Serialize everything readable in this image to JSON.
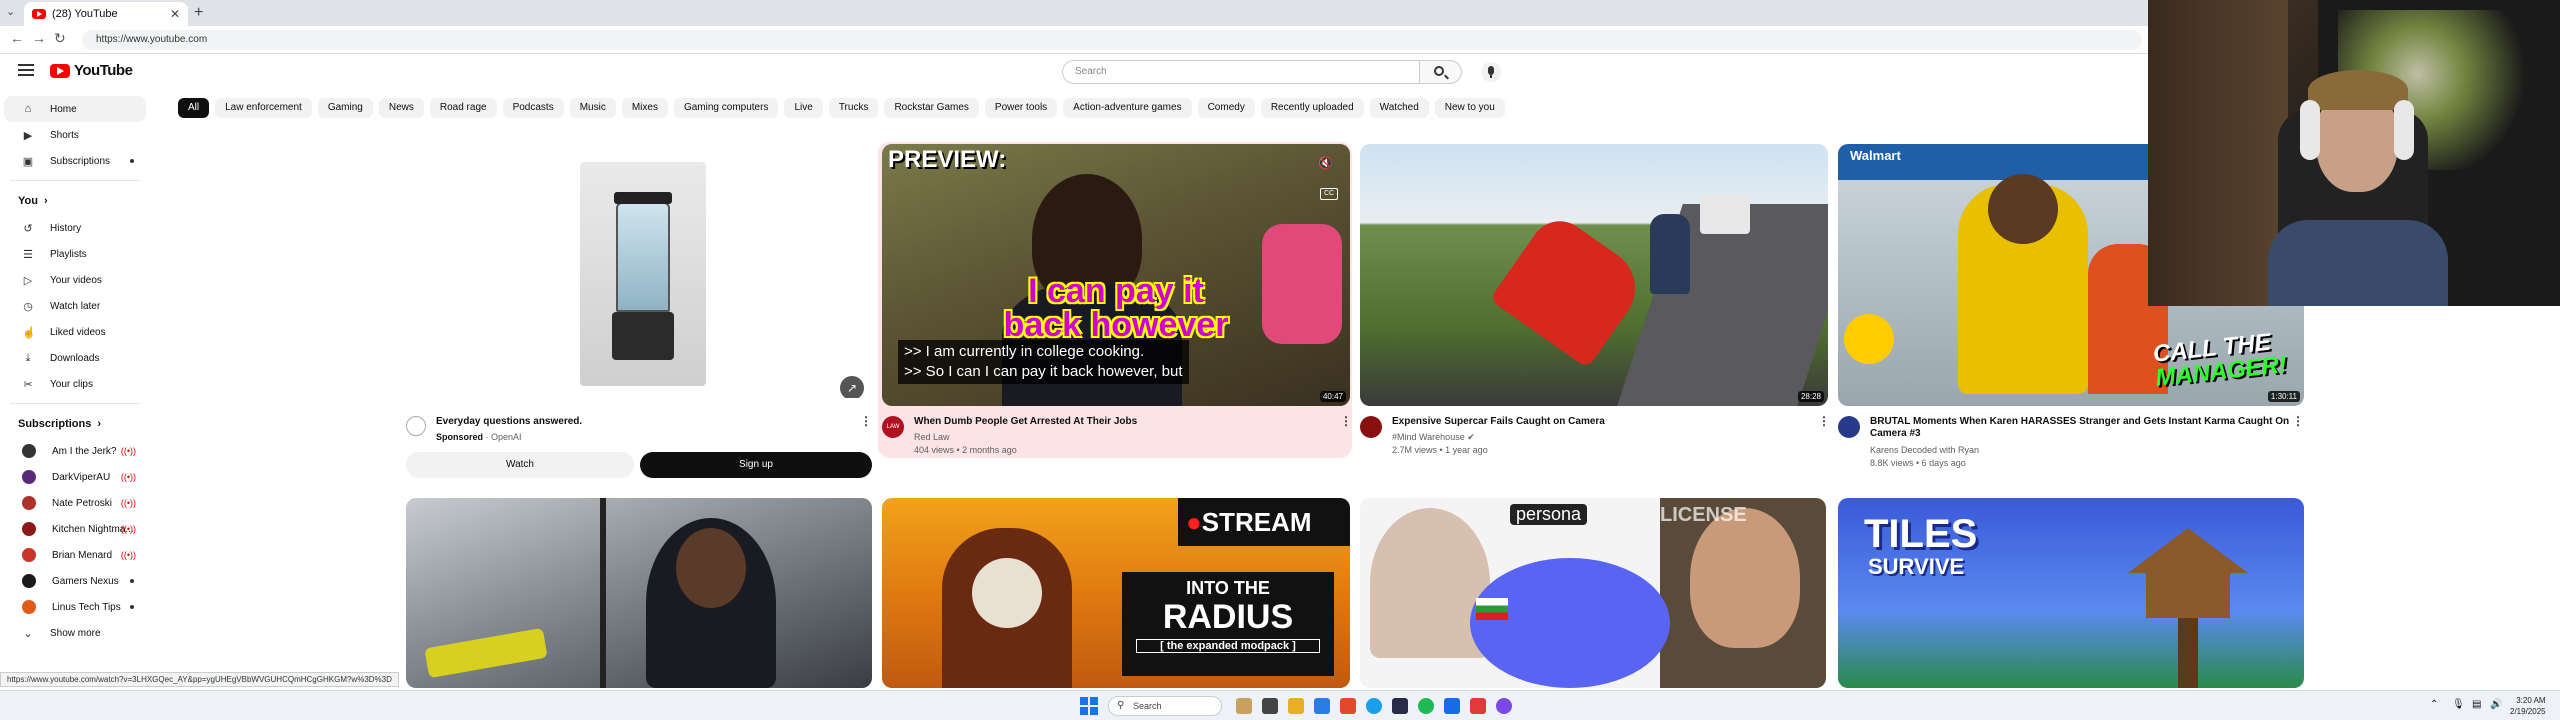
{
  "browser": {
    "tab_title": "(28) YouTube",
    "url": "https://www.youtube.com",
    "status_url": "https://www.youtube.com/watch?v=3LHXGQec_AY&pp=ygUHEgVBbWVGUHCQmHCgGHKGM?w%3D%3D"
  },
  "header": {
    "logo_text": "YouTube",
    "search_placeholder": "Search"
  },
  "chips": [
    "All",
    "Law enforcement",
    "Gaming",
    "News",
    "Road rage",
    "Podcasts",
    "Music",
    "Mixes",
    "Gaming computers",
    "Live",
    "Trucks",
    "Rockstar Games",
    "Power tools",
    "Action-adventure games",
    "Comedy",
    "Recently uploaded",
    "Watched",
    "New to you"
  ],
  "sidebar": {
    "main": [
      {
        "label": "Home",
        "icon": "home-icon"
      },
      {
        "label": "Shorts",
        "icon": "shorts-icon"
      },
      {
        "label": "Subscriptions",
        "icon": "subscriptions-icon"
      }
    ],
    "you_heading": "You",
    "you": [
      {
        "label": "History",
        "icon": "history-icon"
      },
      {
        "label": "Playlists",
        "icon": "playlists-icon"
      },
      {
        "label": "Your videos",
        "icon": "your-videos-icon"
      },
      {
        "label": "Watch later",
        "icon": "watch-later-icon"
      },
      {
        "label": "Liked videos",
        "icon": "liked-icon"
      },
      {
        "label": "Downloads",
        "icon": "downloads-icon"
      },
      {
        "label": "Your clips",
        "icon": "clips-icon"
      }
    ],
    "subs_heading": "Subscriptions",
    "subscriptions": [
      {
        "label": "Am I the Jerk?",
        "color": "#333333",
        "live": true
      },
      {
        "label": "DarkViperAU",
        "color": "#5a2a7a",
        "live": true
      },
      {
        "label": "Nate Petroski",
        "color": "#b0302a",
        "live": true
      },
      {
        "label": "Kitchen Nightma...",
        "color": "#8a1a1a",
        "live": true
      },
      {
        "label": "Brian Menard",
        "color": "#c8342a",
        "live": true
      },
      {
        "label": "Gamers Nexus",
        "color": "#1a1a1a",
        "live": false
      },
      {
        "label": "Linus Tech Tips",
        "color": "#e05a1a",
        "live": false
      }
    ],
    "show_more": "Show more"
  },
  "ad": {
    "title": "Everyday questions answered.",
    "sponsored": "Sponsored",
    "advertiser": "OpenAI",
    "watch_label": "Watch",
    "signup_label": "Sign up"
  },
  "videos": [
    {
      "title": "When Dumb People Get Arrested At Their Jobs",
      "channel": "Red Law",
      "meta": "404 views • 2 months ago",
      "duration": "40:47",
      "preview_label": "PREVIEW:",
      "caption_big1": "I can pay it",
      "caption_big2": "back however",
      "cc_line1": ">> I am currently in college cooking.",
      "cc_line2": ">> So I can I can pay it back however, but",
      "avatar_color": "#b01020"
    },
    {
      "title": "Expensive Supercar Fails Caught on Camera",
      "channel": "#Mind Warehouse",
      "meta": "2.7M views • 1 year ago",
      "duration": "28:28",
      "avatar_color": "#8a1010"
    },
    {
      "title": "BRUTAL Moments When Karen HARASSES Stranger and Gets Instant Karma Caught On Camera #3",
      "channel": "Karens Decoded with Ryan",
      "meta": "8.8K views • 6 days ago",
      "duration": "1:30:11",
      "overlay_line1": "CALL THE",
      "overlay_line2": "MANAGER!",
      "avatar_color": "#2a3a8a"
    }
  ],
  "row2": {
    "stream_label": "STREAM",
    "radius_line1": "INTO THE",
    "radius_line2": "RADIUS",
    "radius_line3": "[ the expanded modpack ]",
    "persona_label": "persona",
    "license_label": "LICENSE",
    "tiles_line1": "TILES",
    "tiles_line2": "SURVIVE"
  },
  "taskbar": {
    "search_label": "Search",
    "time": "3:20 AM",
    "date": "2/19/2025"
  }
}
